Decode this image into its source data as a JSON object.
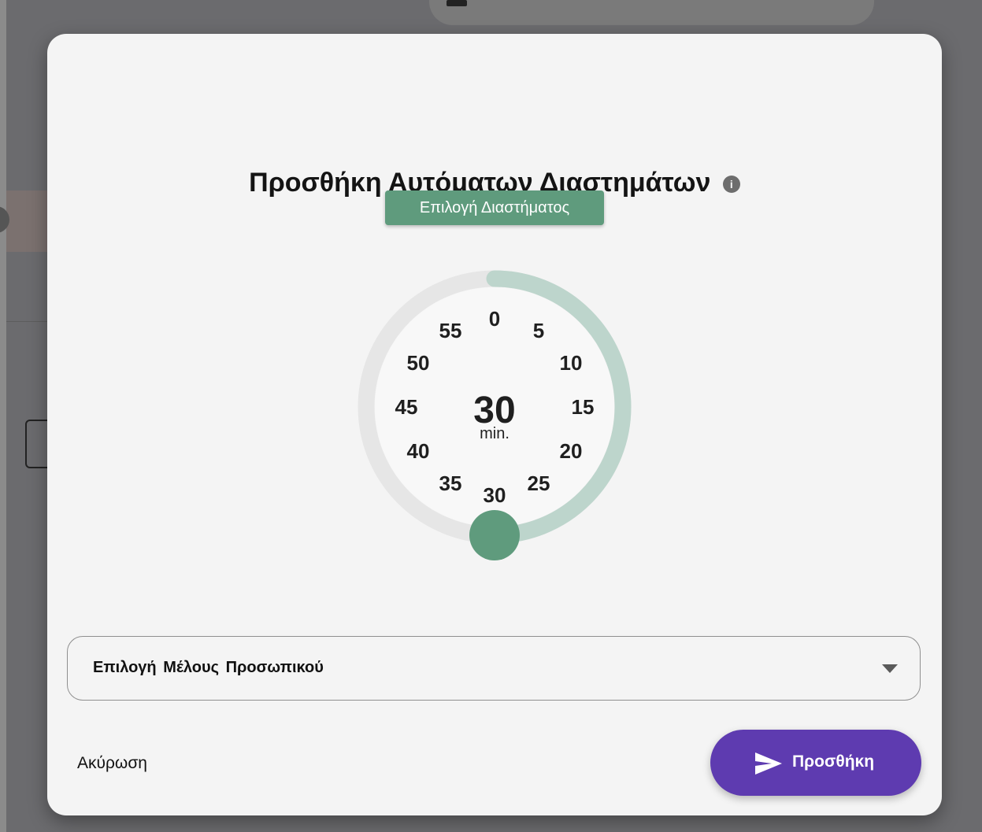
{
  "modal": {
    "title": "Προσθήκη Αυτόματων Διαστημάτων",
    "info_icon": "info-icon",
    "interval_button_label": "Επιλογή Διαστήματος",
    "dial": {
      "selected_value": "30",
      "unit": "min.",
      "numbers": [
        "0",
        "5",
        "10",
        "15",
        "20",
        "25",
        "30",
        "35",
        "40",
        "45",
        "50",
        "55"
      ],
      "selected_fraction": 0.5,
      "colors": {
        "accent": "#5f9b7d",
        "track": "#e6e6e6",
        "progress": "#bdd5cc",
        "face": "#f8f8f8"
      }
    },
    "staff_select": {
      "label": "Επιλογή Μέλους Προσωπικού",
      "icon": "chevron-down-icon"
    },
    "cancel_label": "Ακύρωση",
    "add_button": {
      "label": "Προσθήκη",
      "icon": "send-icon",
      "color": "#5e3bb0"
    }
  }
}
